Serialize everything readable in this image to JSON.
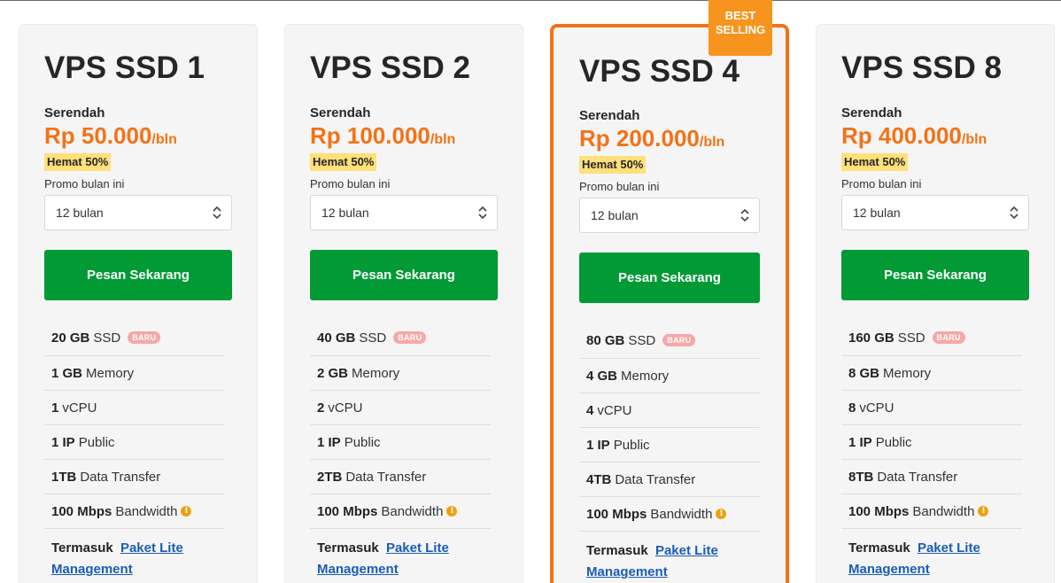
{
  "plans": [
    {
      "title": "VPS SSD 1",
      "from_label": "Serendah",
      "price": "Rp 50.000",
      "per": "/bln",
      "save": "Hemat 50%",
      "promo": "Promo bulan ini",
      "period": "12 bulan",
      "button": "Pesan Sekarang",
      "features": [
        {
          "bold": "20 GB",
          "text": "SSD",
          "badge": "BARU"
        },
        {
          "bold": "1 GB",
          "text": "Memory"
        },
        {
          "bold": "1",
          "text": "vCPU"
        },
        {
          "bold": "1 IP",
          "text": "Public"
        },
        {
          "bold": "1TB",
          "text": "Data Transfer"
        },
        {
          "bold": "100 Mbps",
          "text": "Bandwidth"
        }
      ],
      "incl_bold": "Termasuk",
      "incl_link": "Paket Lite Management"
    },
    {
      "title": "VPS SSD 2",
      "from_label": "Serendah",
      "price": "Rp 100.000",
      "per": "/bln",
      "save": "Hemat 50%",
      "promo": "Promo bulan ini",
      "period": "12 bulan",
      "button": "Pesan Sekarang",
      "features": [
        {
          "bold": "40 GB",
          "text": "SSD",
          "badge": "BARU"
        },
        {
          "bold": "2 GB",
          "text": "Memory"
        },
        {
          "bold": "2",
          "text": "vCPU"
        },
        {
          "bold": "1 IP",
          "text": "Public"
        },
        {
          "bold": "2TB",
          "text": "Data Transfer"
        },
        {
          "bold": "100 Mbps",
          "text": "Bandwidth"
        }
      ],
      "incl_bold": "Termasuk",
      "incl_link": "Paket Lite Management"
    },
    {
      "title": "VPS SSD 4",
      "ribbon": "BEST SELLING",
      "from_label": "Serendah",
      "price": "Rp 200.000",
      "per": "/bln",
      "save": "Hemat 50%",
      "promo": "Promo bulan ini",
      "period": "12 bulan",
      "button": "Pesan Sekarang",
      "features": [
        {
          "bold": "80 GB",
          "text": "SSD",
          "badge": "BARU"
        },
        {
          "bold": "4 GB",
          "text": "Memory"
        },
        {
          "bold": "4",
          "text": "vCPU"
        },
        {
          "bold": "1 IP",
          "text": "Public"
        },
        {
          "bold": "4TB",
          "text": "Data Transfer"
        },
        {
          "bold": "100 Mbps",
          "text": "Bandwidth"
        }
      ],
      "incl_bold": "Termasuk",
      "incl_link": "Paket Lite Management"
    },
    {
      "title": "VPS SSD 8",
      "from_label": "Serendah",
      "price": "Rp 400.000",
      "per": "/bln",
      "save": "Hemat 50%",
      "promo": "Promo bulan ini",
      "period": "12 bulan",
      "button": "Pesan Sekarang",
      "features": [
        {
          "bold": "160 GB",
          "text": "SSD",
          "badge": "BARU"
        },
        {
          "bold": "8 GB",
          "text": "Memory"
        },
        {
          "bold": "8",
          "text": "vCPU"
        },
        {
          "bold": "1 IP",
          "text": "Public"
        },
        {
          "bold": "8TB",
          "text": "Data Transfer"
        },
        {
          "bold": "100 Mbps",
          "text": "Bandwidth"
        }
      ],
      "incl_bold": "Termasuk",
      "incl_link": "Paket Lite Management"
    }
  ],
  "colors": {
    "accent": "#f47216",
    "cta": "#029a35",
    "save_badge": "#ffe07a",
    "link": "#1a5db7"
  },
  "icons": {
    "select_chevron": "chevron-up-down-icon",
    "info": "info-icon"
  }
}
